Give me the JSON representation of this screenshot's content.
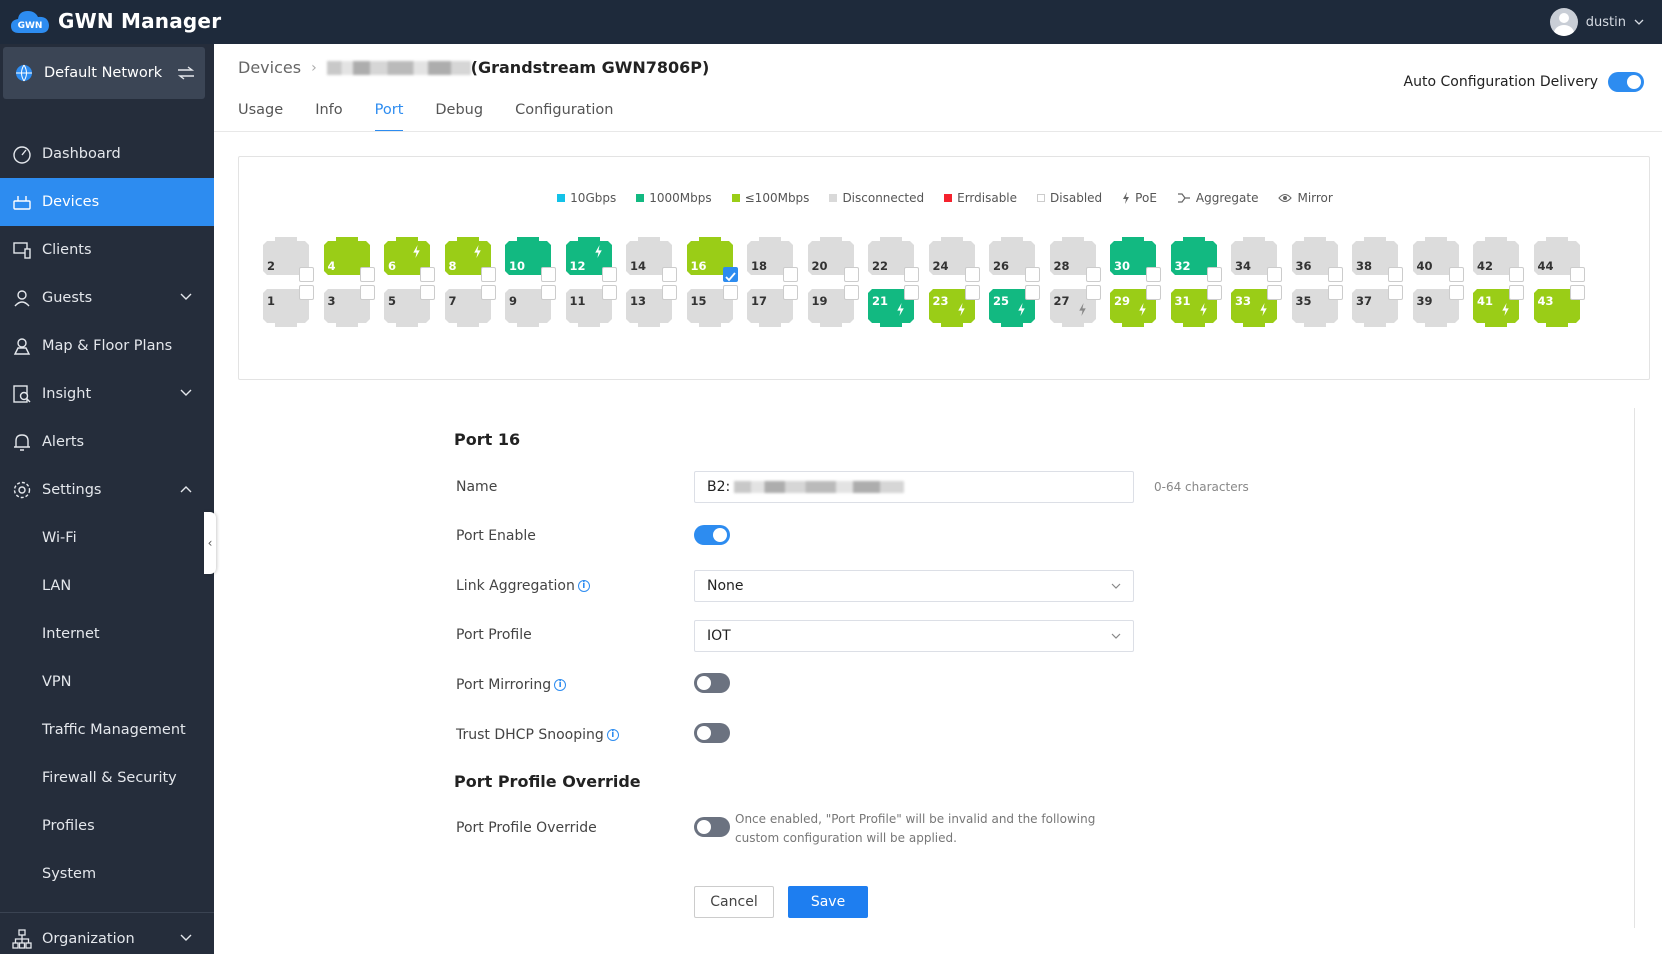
{
  "app": {
    "title": "GWN Manager",
    "user": "dustin"
  },
  "sidebar": {
    "network": "Default Network",
    "items": [
      {
        "label": "Dashboard",
        "icon": "dashboard-icon"
      },
      {
        "label": "Devices",
        "icon": "devices-icon",
        "active": true
      },
      {
        "label": "Clients",
        "icon": "clients-icon"
      },
      {
        "label": "Guests",
        "icon": "guests-icon",
        "expandable": true
      },
      {
        "label": "Map & Floor Plans",
        "icon": "map-icon"
      },
      {
        "label": "Insight",
        "icon": "insight-icon",
        "expandable": true
      },
      {
        "label": "Alerts",
        "icon": "bell-icon"
      },
      {
        "label": "Settings",
        "icon": "gear-icon",
        "expanded": true
      }
    ],
    "settings_sub": [
      "Wi-Fi",
      "LAN",
      "Internet",
      "VPN",
      "Traffic Management",
      "Firewall & Security",
      "Profiles",
      "System"
    ],
    "organization": "Organization"
  },
  "header": {
    "breadcrumb_root": "Devices",
    "device_name": "(Grandstream GWN7806P)",
    "auto_config": "Auto Configuration Delivery",
    "tabs": [
      "Usage",
      "Info",
      "Port",
      "Debug",
      "Configuration"
    ],
    "active_tab": "Port"
  },
  "legend": [
    {
      "label": "10Gbps",
      "color": "#13c2e8"
    },
    {
      "label": "1000Mbps",
      "color": "#12b981"
    },
    {
      "label": "≤100Mbps",
      "color": "#9acd17"
    },
    {
      "label": "Disconnected",
      "color": "#d9d9d9"
    },
    {
      "label": "Errdisable",
      "color": "#f5222d"
    },
    {
      "label": "Disabled",
      "color": "#ffffff"
    },
    {
      "label": "PoE",
      "icon": "bolt-icon"
    },
    {
      "label": "Aggregate",
      "icon": "aggregate-icon"
    },
    {
      "label": "Mirror",
      "icon": "eye-icon"
    }
  ],
  "ports": {
    "top": [
      {
        "n": "2",
        "s": "d"
      },
      {
        "n": "4",
        "s": "g"
      },
      {
        "n": "6",
        "s": "g",
        "poe": true
      },
      {
        "n": "8",
        "s": "g",
        "poe": true
      },
      {
        "n": "10",
        "s": "t"
      },
      {
        "n": "12",
        "s": "t",
        "poe": true
      },
      {
        "n": "14",
        "s": "d"
      },
      {
        "n": "16",
        "s": "g",
        "checked": true
      },
      {
        "n": "18",
        "s": "d"
      },
      {
        "n": "20",
        "s": "d"
      },
      {
        "n": "22",
        "s": "d"
      },
      {
        "n": "24",
        "s": "d"
      },
      {
        "n": "26",
        "s": "d"
      },
      {
        "n": "28",
        "s": "d"
      },
      {
        "n": "30",
        "s": "t"
      },
      {
        "n": "32",
        "s": "t"
      },
      {
        "n": "34",
        "s": "d"
      },
      {
        "n": "36",
        "s": "d"
      },
      {
        "n": "38",
        "s": "d"
      },
      {
        "n": "40",
        "s": "d"
      },
      {
        "n": "42",
        "s": "d"
      },
      {
        "n": "44",
        "s": "d"
      }
    ],
    "bottom": [
      {
        "n": "1",
        "s": "d"
      },
      {
        "n": "3",
        "s": "d"
      },
      {
        "n": "5",
        "s": "d"
      },
      {
        "n": "7",
        "s": "d"
      },
      {
        "n": "9",
        "s": "d"
      },
      {
        "n": "11",
        "s": "d"
      },
      {
        "n": "13",
        "s": "d"
      },
      {
        "n": "15",
        "s": "d"
      },
      {
        "n": "17",
        "s": "d"
      },
      {
        "n": "19",
        "s": "d"
      },
      {
        "n": "21",
        "s": "t",
        "poe": true
      },
      {
        "n": "23",
        "s": "g",
        "poe": true
      },
      {
        "n": "25",
        "s": "t",
        "poe": true
      },
      {
        "n": "27",
        "s": "d",
        "poe": true
      },
      {
        "n": "29",
        "s": "g",
        "poe": true
      },
      {
        "n": "31",
        "s": "g",
        "poe": true
      },
      {
        "n": "33",
        "s": "g",
        "poe": true
      },
      {
        "n": "35",
        "s": "d"
      },
      {
        "n": "37",
        "s": "d"
      },
      {
        "n": "39",
        "s": "d"
      },
      {
        "n": "41",
        "s": "g",
        "poe": true
      },
      {
        "n": "43",
        "s": "g"
      }
    ]
  },
  "form": {
    "title": "Port 16",
    "name_label": "Name",
    "name_value": "B2:",
    "name_hint": "0-64 characters",
    "port_enable": "Port Enable",
    "link_agg": "Link Aggregation",
    "link_agg_value": "None",
    "port_profile": "Port Profile",
    "port_profile_value": "IOT",
    "port_mirroring": "Port Mirroring",
    "trust_dhcp": "Trust DHCP Snooping",
    "override_title": "Port Profile Override",
    "override_label": "Port Profile Override",
    "override_note": "Once enabled, \"Port Profile\" will be invalid and the following custom configuration will be applied.",
    "cancel": "Cancel",
    "save": "Save"
  }
}
